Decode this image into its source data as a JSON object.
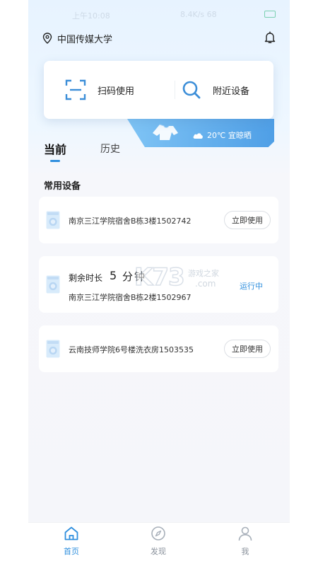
{
  "status_bar": {
    "left_text": "上午10:08",
    "right_text": "8.4K/s  68",
    "battery_level": "28"
  },
  "header": {
    "location": "中国传媒大学"
  },
  "actions": {
    "scan_label": "扫码使用",
    "nearby_label": "附近设备"
  },
  "weather": {
    "text": "20℃ 宜晾晒"
  },
  "tabs": [
    {
      "label": "当前",
      "active": true
    },
    {
      "label": "历史",
      "active": false
    }
  ],
  "section": {
    "title": "常用设备"
  },
  "devices": [
    {
      "name": "南京三江学院宿舍B栋3楼1502742",
      "button": "立即使用"
    },
    {
      "name": "南京三江学院宿舍B栋2楼1502967",
      "remain_label": "剩余时长",
      "remain_value": "5",
      "remain_unit": "分钟",
      "status": "运行中"
    },
    {
      "name": "云南技师学院6号楼洗衣房1503535",
      "button": "立即使用"
    }
  ],
  "watermark": {
    "brand": "K73",
    "line1": "游戏之家",
    "line2": ".com"
  },
  "nav": [
    {
      "label": "首页",
      "icon": "home-icon",
      "active": true
    },
    {
      "label": "发现",
      "icon": "compass-icon",
      "active": false
    },
    {
      "label": "我",
      "icon": "user-icon",
      "active": false
    }
  ],
  "colors": {
    "accent": "#2f8fde",
    "weather_band": "#5aa7ea",
    "inactive": "#a8b0ba",
    "background": "#f5f6fa"
  }
}
